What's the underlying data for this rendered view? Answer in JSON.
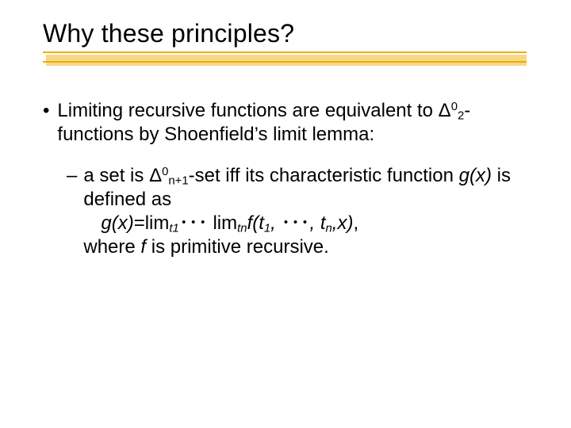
{
  "title": "Why these principles?",
  "bullet": {
    "pre": "Limiting recursive functions are equivalent to ",
    "delta": "Δ",
    "sup0": "0",
    "sub2": "2",
    "post": "-functions by Shoenfield’s limit lemma:"
  },
  "sub": {
    "line1_pre": "a set is ",
    "delta": "Δ",
    "sup0": "0",
    "subn1": "n+1",
    "line1_post": "-set iff its characteristic function ",
    "gx": "g(x)",
    "line1_tail": " is defined as",
    "eq_g": "g(x)",
    "eq_eq": "=lim",
    "eq_t1": "t",
    "eq_t1n": "1",
    "eq_dots1": "･･･ ",
    "eq_lim2": "lim",
    "eq_tn": "t",
    "eq_tnn": "n",
    "eq_f": "f(t",
    "eq_f1": "1",
    "eq_com": ", ",
    "eq_dots2": "･･･",
    "eq_comtn": ", t",
    "eq_fn": "n",
    "eq_comx": ",x)",
    "eq_tail": ",",
    "line3_pre": "where ",
    "f": "f",
    "line3_post": " is primitive recursive."
  }
}
